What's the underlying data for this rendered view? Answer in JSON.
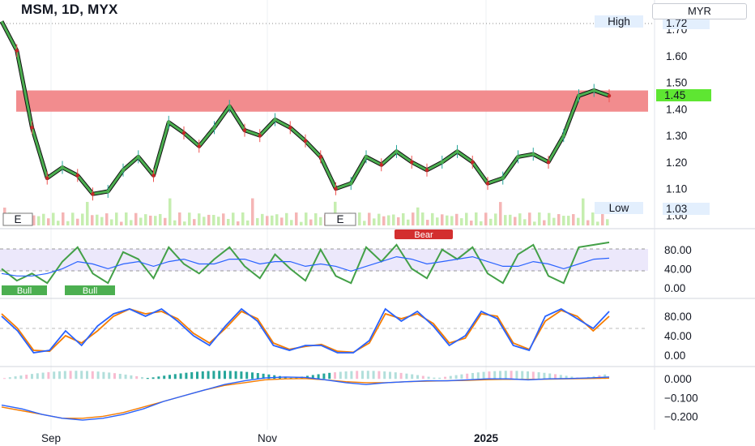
{
  "header": {
    "title": "MSM, 1D, MYX",
    "currency": "MYR"
  },
  "price_labels": {
    "high": "High",
    "high_value": "1.72",
    "low": "Low",
    "low_value": "1.03",
    "last": "1.45"
  },
  "earnings_marker": "E",
  "oscillator_labels": {
    "bull": "Bull",
    "bear": "Bear"
  },
  "colors": {
    "resistance_zone": "#f28c8e",
    "last_price": "#5ee632",
    "bull_cloud": "#4caf50",
    "bear_cloud": "#c62828",
    "candle_up": "#26a69a",
    "candle_down": "#ef5350",
    "blue_line": "#2962ff",
    "orange_line": "#f57c00",
    "green_osc": "#43a047"
  },
  "chart_data": [
    {
      "type": "line",
      "name": "price",
      "ylim": [
        0.98,
        1.78
      ],
      "yticks": [
        "1.70",
        "1.60",
        "1.50",
        "1.40",
        "1.30",
        "1.20",
        "1.10",
        "1.03",
        "1.00"
      ],
      "xticks": [
        "Sep",
        "Nov",
        "2025"
      ],
      "x": [
        0,
        4,
        8,
        12,
        16,
        20,
        24,
        28,
        32,
        36,
        40,
        44,
        48,
        52,
        56,
        60,
        64,
        68,
        72,
        76,
        80,
        84,
        88,
        92,
        96,
        100,
        104,
        108,
        112,
        116,
        120,
        124,
        128,
        132,
        136,
        140,
        144,
        148,
        152,
        156,
        160
      ],
      "values": [
        1.73,
        1.62,
        1.33,
        1.14,
        1.18,
        1.15,
        1.08,
        1.09,
        1.17,
        1.22,
        1.15,
        1.35,
        1.31,
        1.26,
        1.33,
        1.41,
        1.32,
        1.3,
        1.36,
        1.33,
        1.28,
        1.22,
        1.1,
        1.12,
        1.22,
        1.19,
        1.24,
        1.2,
        1.17,
        1.2,
        1.24,
        1.2,
        1.12,
        1.14,
        1.22,
        1.23,
        1.2,
        1.3,
        1.45,
        1.47,
        1.45
      ],
      "resistance_zone": [
        1.39,
        1.47
      ],
      "high": 1.72,
      "low": 1.03,
      "last": 1.45
    },
    {
      "type": "line",
      "name": "oscillator-1",
      "ylim": [
        0,
        100
      ],
      "yticks": [
        "80.00",
        "40.00",
        "0.00"
      ],
      "values": [
        40,
        15,
        30,
        10,
        55,
        85,
        30,
        10,
        75,
        60,
        20,
        85,
        50,
        30,
        60,
        85,
        45,
        20,
        70,
        40,
        15,
        80,
        25,
        10,
        85,
        55,
        90,
        40,
        20,
        80,
        60,
        85,
        30,
        10,
        70,
        90,
        25,
        10,
        85,
        90,
        95
      ],
      "signal": [
        30,
        25,
        25,
        30,
        40,
        55,
        50,
        40,
        50,
        55,
        45,
        55,
        60,
        50,
        50,
        60,
        60,
        50,
        55,
        55,
        45,
        50,
        45,
        35,
        45,
        55,
        65,
        60,
        50,
        55,
        60,
        65,
        55,
        45,
        45,
        55,
        50,
        40,
        50,
        60,
        62
      ]
    },
    {
      "type": "line",
      "name": "oscillator-2",
      "ylim": [
        0,
        100
      ],
      "yticks": [
        "80.00",
        "40.00",
        "0.00"
      ],
      "values": [
        80,
        50,
        5,
        10,
        50,
        20,
        60,
        85,
        95,
        80,
        95,
        70,
        40,
        20,
        60,
        95,
        70,
        20,
        10,
        20,
        20,
        5,
        5,
        30,
        95,
        70,
        90,
        60,
        20,
        40,
        90,
        75,
        20,
        10,
        80,
        95,
        75,
        55,
        90
      ],
      "signal": [
        85,
        55,
        10,
        8,
        40,
        25,
        50,
        80,
        95,
        85,
        90,
        75,
        45,
        25,
        55,
        90,
        75,
        25,
        12,
        18,
        22,
        8,
        6,
        25,
        85,
        75,
        85,
        65,
        25,
        35,
        85,
        80,
        25,
        12,
        70,
        92,
        80,
        50,
        80
      ]
    },
    {
      "type": "line",
      "name": "macd",
      "ylim": [
        -0.25,
        0.04
      ],
      "yticks": [
        "0.000",
        "−0.100",
        "−0.200"
      ],
      "values": [
        -0.14,
        -0.16,
        -0.19,
        -0.21,
        -0.22,
        -0.21,
        -0.19,
        -0.16,
        -0.12,
        -0.09,
        -0.06,
        -0.03,
        -0.01,
        0.005,
        0.01,
        0.008,
        -0.005,
        -0.02,
        -0.03,
        -0.02,
        -0.015,
        -0.01,
        -0.01,
        -0.005,
        0.0,
        0.0,
        -0.005,
        0.0,
        0.002,
        0.005,
        0.01
      ],
      "signal": [
        -0.15,
        -0.17,
        -0.19,
        -0.21,
        -0.21,
        -0.2,
        -0.18,
        -0.15,
        -0.12,
        -0.09,
        -0.06,
        -0.035,
        -0.02,
        -0.005,
        0.0,
        0.002,
        -0.005,
        -0.015,
        -0.02,
        -0.02,
        -0.015,
        -0.012,
        -0.01,
        -0.008,
        -0.004,
        -0.002,
        -0.003,
        -0.001,
        0.0,
        0.002,
        0.004
      ]
    }
  ]
}
